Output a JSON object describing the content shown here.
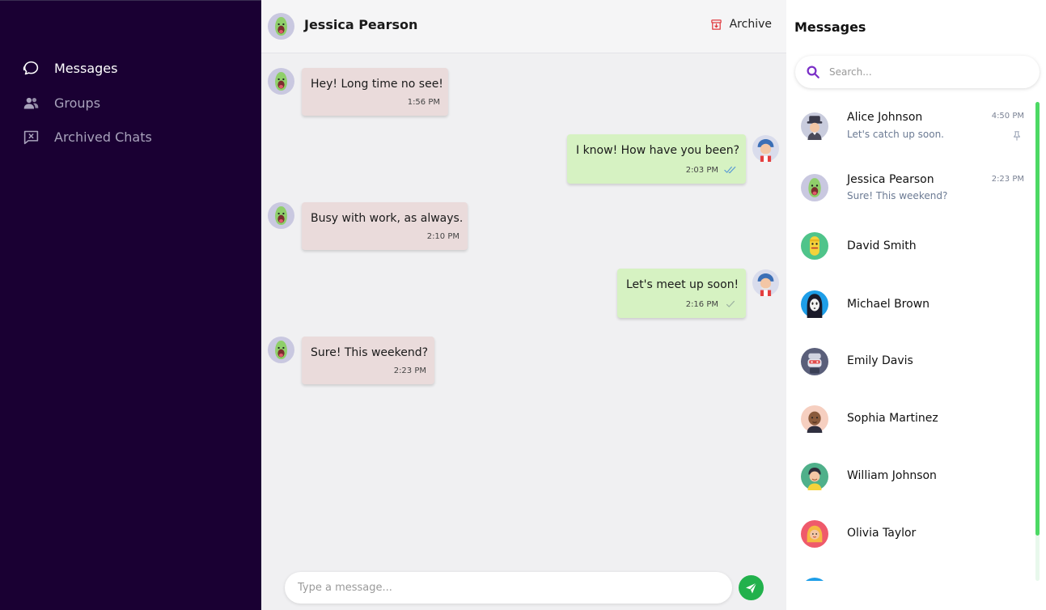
{
  "nav": {
    "items": [
      {
        "label": "Messages",
        "icon": "chat-bubble-icon",
        "active": true
      },
      {
        "label": "Groups",
        "icon": "users-icon",
        "active": false
      },
      {
        "label": "Archived Chats",
        "icon": "archived-chat-icon",
        "active": false
      }
    ]
  },
  "chat": {
    "contact_name": "Jessica Pearson",
    "archive_label": "Archive",
    "messages": [
      {
        "direction": "in",
        "text": "Hey! Long time no see!",
        "time": "1:56 PM"
      },
      {
        "direction": "out",
        "text": "I know! How have you been?",
        "time": "2:03 PM",
        "status": "read"
      },
      {
        "direction": "in",
        "text": "Busy with work, as always.",
        "time": "2:10 PM"
      },
      {
        "direction": "out",
        "text": "Let's meet up soon!",
        "time": "2:16 PM",
        "status": "sent"
      },
      {
        "direction": "in",
        "text": "Sure! This weekend?",
        "time": "2:23 PM"
      }
    ],
    "composer_placeholder": "Type a message..."
  },
  "panel": {
    "title": "Messages",
    "search_placeholder": "Search...",
    "contacts": [
      {
        "name": "Alice Johnson",
        "preview": "Let's catch up soon.",
        "time": "4:50 PM",
        "pinned": true
      },
      {
        "name": "Jessica Pearson",
        "preview": "Sure! This weekend?",
        "time": "2:23 PM",
        "pinned": false
      },
      {
        "name": "David Smith",
        "preview": "",
        "time": "",
        "pinned": false
      },
      {
        "name": "Michael Brown",
        "preview": "",
        "time": "",
        "pinned": false
      },
      {
        "name": "Emily Davis",
        "preview": "",
        "time": "",
        "pinned": false
      },
      {
        "name": "Sophia Martinez",
        "preview": "",
        "time": "",
        "pinned": false
      },
      {
        "name": "William Johnson",
        "preview": "",
        "time": "",
        "pinned": false
      },
      {
        "name": "Olivia Taylor",
        "preview": "",
        "time": "",
        "pinned": false
      }
    ]
  },
  "colors": {
    "nav_bg": "#1a0033",
    "bubble_in": "#eadbdb",
    "bubble_out": "#d6f2c2",
    "send_button": "#22b14c",
    "scroll_thumb": "#4cd964",
    "search_icon": "#7a2fc7",
    "archive_icon": "#e0393e"
  }
}
